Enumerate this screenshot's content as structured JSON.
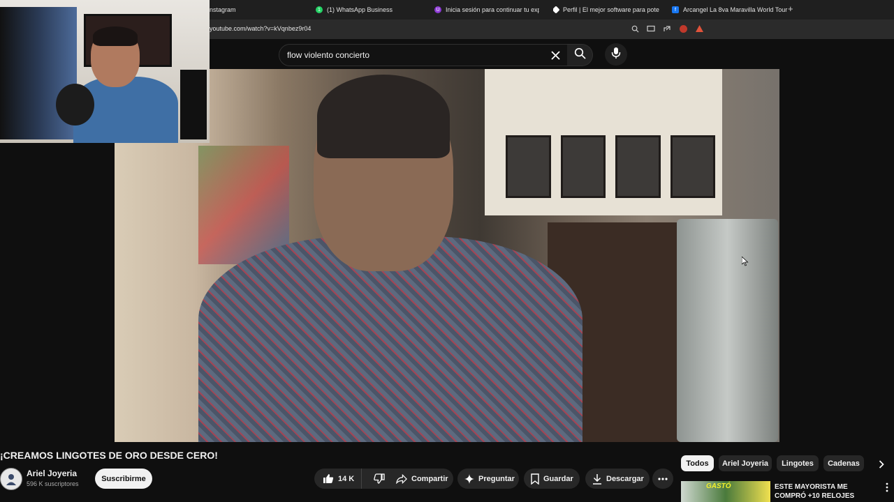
{
  "browser": {
    "tabs": [
      {
        "label": "nstagram"
      },
      {
        "label": "(1) WhatsApp Business",
        "favicon": "whatsapp-icon",
        "color": "#25d366"
      },
      {
        "label": "Inicia sesión para continuar tu experi",
        "favicon": "purple-shield-icon",
        "color": "#8e3bd6"
      },
      {
        "label": "Perfil | El mejor software para potenc",
        "favicon": "diamond-icon",
        "color": "#ffffff"
      },
      {
        "label": "Arcangel La 8va Maravilla World Tour",
        "favicon": "facebook-icon",
        "color": "#1877f2"
      }
    ],
    "new_tab": "+",
    "url": "youtube.com/watch?v=kVqnbez9r04"
  },
  "youtube": {
    "search": {
      "query": "flow violento concierto"
    },
    "video": {
      "title": "¡CREAMOS LINGOTES DE ORO DESDE CERO!"
    },
    "channel": {
      "name": "Ariel Joyeria",
      "subscribers": "596 K suscriptores",
      "subscribe_label": "Suscribirme"
    },
    "actions": {
      "likes": "14 K",
      "share": "Compartir",
      "ask": "Preguntar",
      "save": "Guardar",
      "download": "Descargar"
    },
    "chips": [
      "Todos",
      "Ariel Joyeria",
      "Lingotes",
      "Cadenas"
    ],
    "recommendation": {
      "thumb_text": "GASTÓ",
      "title": "ESTE MAYORISTA ME COMPRÓ +10 RELOJES"
    }
  },
  "colors": {
    "background": "#0f0f0f",
    "pill": "#272727",
    "text": "#f1f1f1"
  }
}
